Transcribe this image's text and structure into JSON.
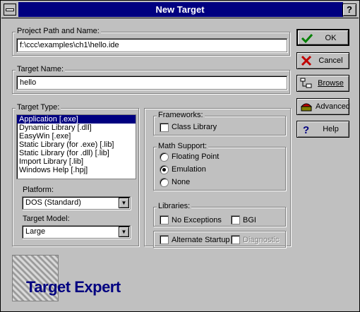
{
  "window": {
    "title": "New Target",
    "help_button": "?"
  },
  "project_path": {
    "label": "Project Path and Name:",
    "value": "f:\\ccc\\examples\\ch1\\hello.ide"
  },
  "target_name": {
    "label": "Target Name:",
    "value": "hello"
  },
  "target_type": {
    "label": "Target Type:",
    "items": [
      "Application [.exe]",
      "Dynamic Library [.dll]",
      "EasyWin [.exe]",
      "Static Library (for .exe) [.lib]",
      "Static Library (for .dll) [.lib]",
      "Import Library [.lib]",
      "Windows Help [.hpj]"
    ],
    "selected_index": 0
  },
  "platform": {
    "label": "Platform:",
    "value": "DOS (Standard)"
  },
  "target_model": {
    "label": "Target Model:",
    "value": "Large"
  },
  "frameworks": {
    "label": "Frameworks:",
    "class_library": "Class Library"
  },
  "math_support": {
    "label": "Math Support:",
    "options": [
      "Floating Point",
      "Emulation",
      "None"
    ],
    "selected": "Emulation"
  },
  "libraries": {
    "label": "Libraries:",
    "no_exceptions": "No Exceptions",
    "bgi": "BGI",
    "alternate_startup": "Alternate Startup",
    "diagnostic": "Diagnostic"
  },
  "buttons": {
    "ok": "OK",
    "cancel": "Cancel",
    "browse": "Browse",
    "advanced": "Advanced",
    "help": "Help"
  },
  "logo": {
    "text": "Target Expert"
  },
  "colors": {
    "selection": "#000080",
    "face": "#c0c0c0",
    "logo_text": "#000080"
  }
}
